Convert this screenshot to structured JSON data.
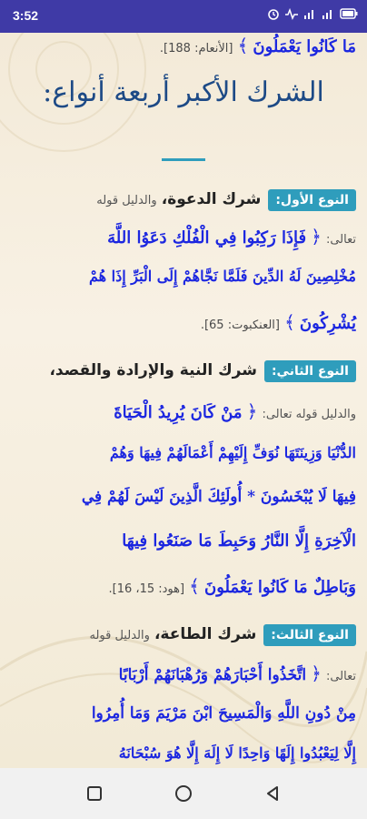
{
  "status_bar": {
    "time": "3:52",
    "icons": [
      "alarm-icon",
      "activity-icon",
      "signal-icon",
      "signal-icon",
      "battery-icon"
    ]
  },
  "top_fragment": {
    "verse": "مَا كَانُوا يَعْمَلُونَ",
    "ref": "[الأنعام: 188]."
  },
  "heading": "الشرك الأكبر أربعة أنواع:",
  "type1": {
    "badge": "النوع الأول:",
    "title": "شرك الدعوة،",
    "lead1": "والدليل قوله",
    "lead2": "تعالى:",
    "verse_line1": "فَإِذَا رَكِبُوا فِي الْفُلْكِ دَعَوُا اللَّهَ",
    "verse_line2": "مُخْلِصِينَ لَهُ الدِّينَ فَلَمَّا نَجَّاهُمْ إِلَى الْبَرِّ إِذَا هُمْ",
    "verse_line3": "يُشْرِكُونَ",
    "ref": "[العنكبوت: 65]."
  },
  "type2": {
    "badge": "النوع الثاني:",
    "title": "شرك النية والإرادة والقصد،",
    "lead": "والدليل قوله تعالى:",
    "verse_line1": "مَنْ كَانَ يُرِيدُ الْحَيَاةَ",
    "verse_line2": "الدُّنْيَا وَزِينَتَهَا نُوَفِّ إِلَيْهِمْ أَعْمَالَهُمْ فِيهَا وَهُمْ",
    "verse_line3": "فِيهَا لَا يُبْخَسُونَ * أُولَئِكَ الَّذِينَ لَيْسَ لَهُمْ فِي",
    "verse_line4": "الْآخِرَةِ إِلَّا النَّارُ وَحَبِطَ مَا صَنَعُوا فِيهَا",
    "verse_line5": "وَبَاطِلٌ مَا كَانُوا يَعْمَلُونَ",
    "ref": "[هود: 15، 16]."
  },
  "type3": {
    "badge": "النوع الثالث:",
    "title": "شرك الطاعة،",
    "lead1": "والدليل قوله",
    "lead2": "تعالى:",
    "verse_line1": "اتَّخَذُوا أَحْبَارَهُمْ وَرُهْبَانَهُمْ أَرْبَابًا",
    "verse_line2": "مِنْ دُونِ اللَّهِ وَالْمَسِيحَ ابْنَ مَرْيَمَ وَمَا أُمِرُوا",
    "verse_line3": "إِلَّا لِيَعْبُدُوا إِلَهًا وَاحِدًا لَا إِلَهَ إِلَّا هُوَ سُبْحَانَهُ"
  },
  "navbar": [
    "square-icon",
    "circle-icon",
    "back-triangle-icon"
  ],
  "colors": {
    "status_bar": "#3f3aa6",
    "badge": "#2f9dbc",
    "verse": "#1c27e0",
    "heading": "#1d4a86"
  }
}
